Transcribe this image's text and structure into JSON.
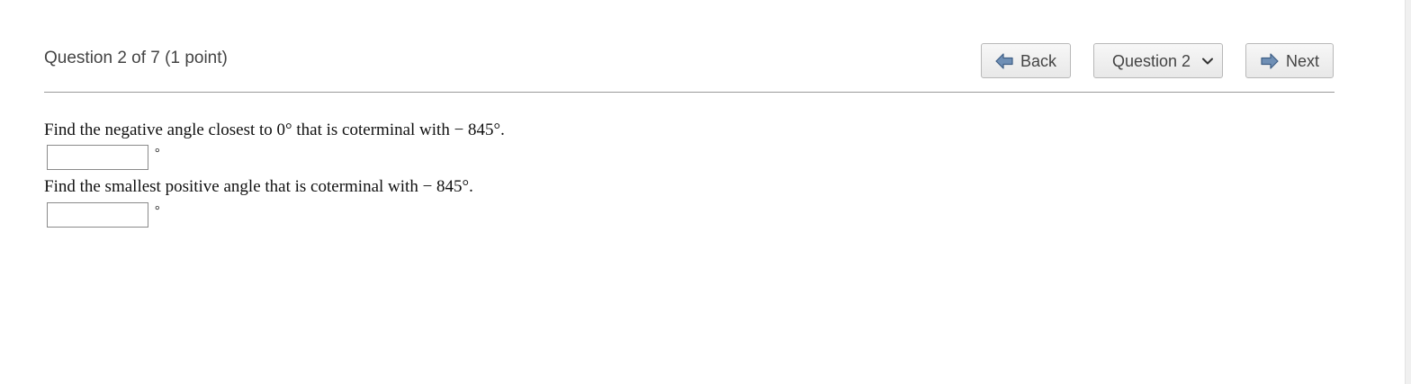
{
  "header": {
    "question_title": "Question 2 of 7 (1 point)",
    "back_label": "Back",
    "question_select_value": "Question 2",
    "next_label": "Next"
  },
  "icons": {
    "back": "arrow-left-icon",
    "next": "arrow-right-icon",
    "select": "chevron-down-icon"
  },
  "colors": {
    "arrow_fill": "#6f8fb5",
    "arrow_stroke": "#3f5f86",
    "divider": "#9a9a9a"
  },
  "questions": [
    {
      "prompt": "Find the negative angle closest to 0° that is coterminal with − 845°.",
      "answer_value": "",
      "unit": "°"
    },
    {
      "prompt": "Find the smallest positive angle that is coterminal with − 845°.",
      "answer_value": "",
      "unit": "°"
    }
  ]
}
